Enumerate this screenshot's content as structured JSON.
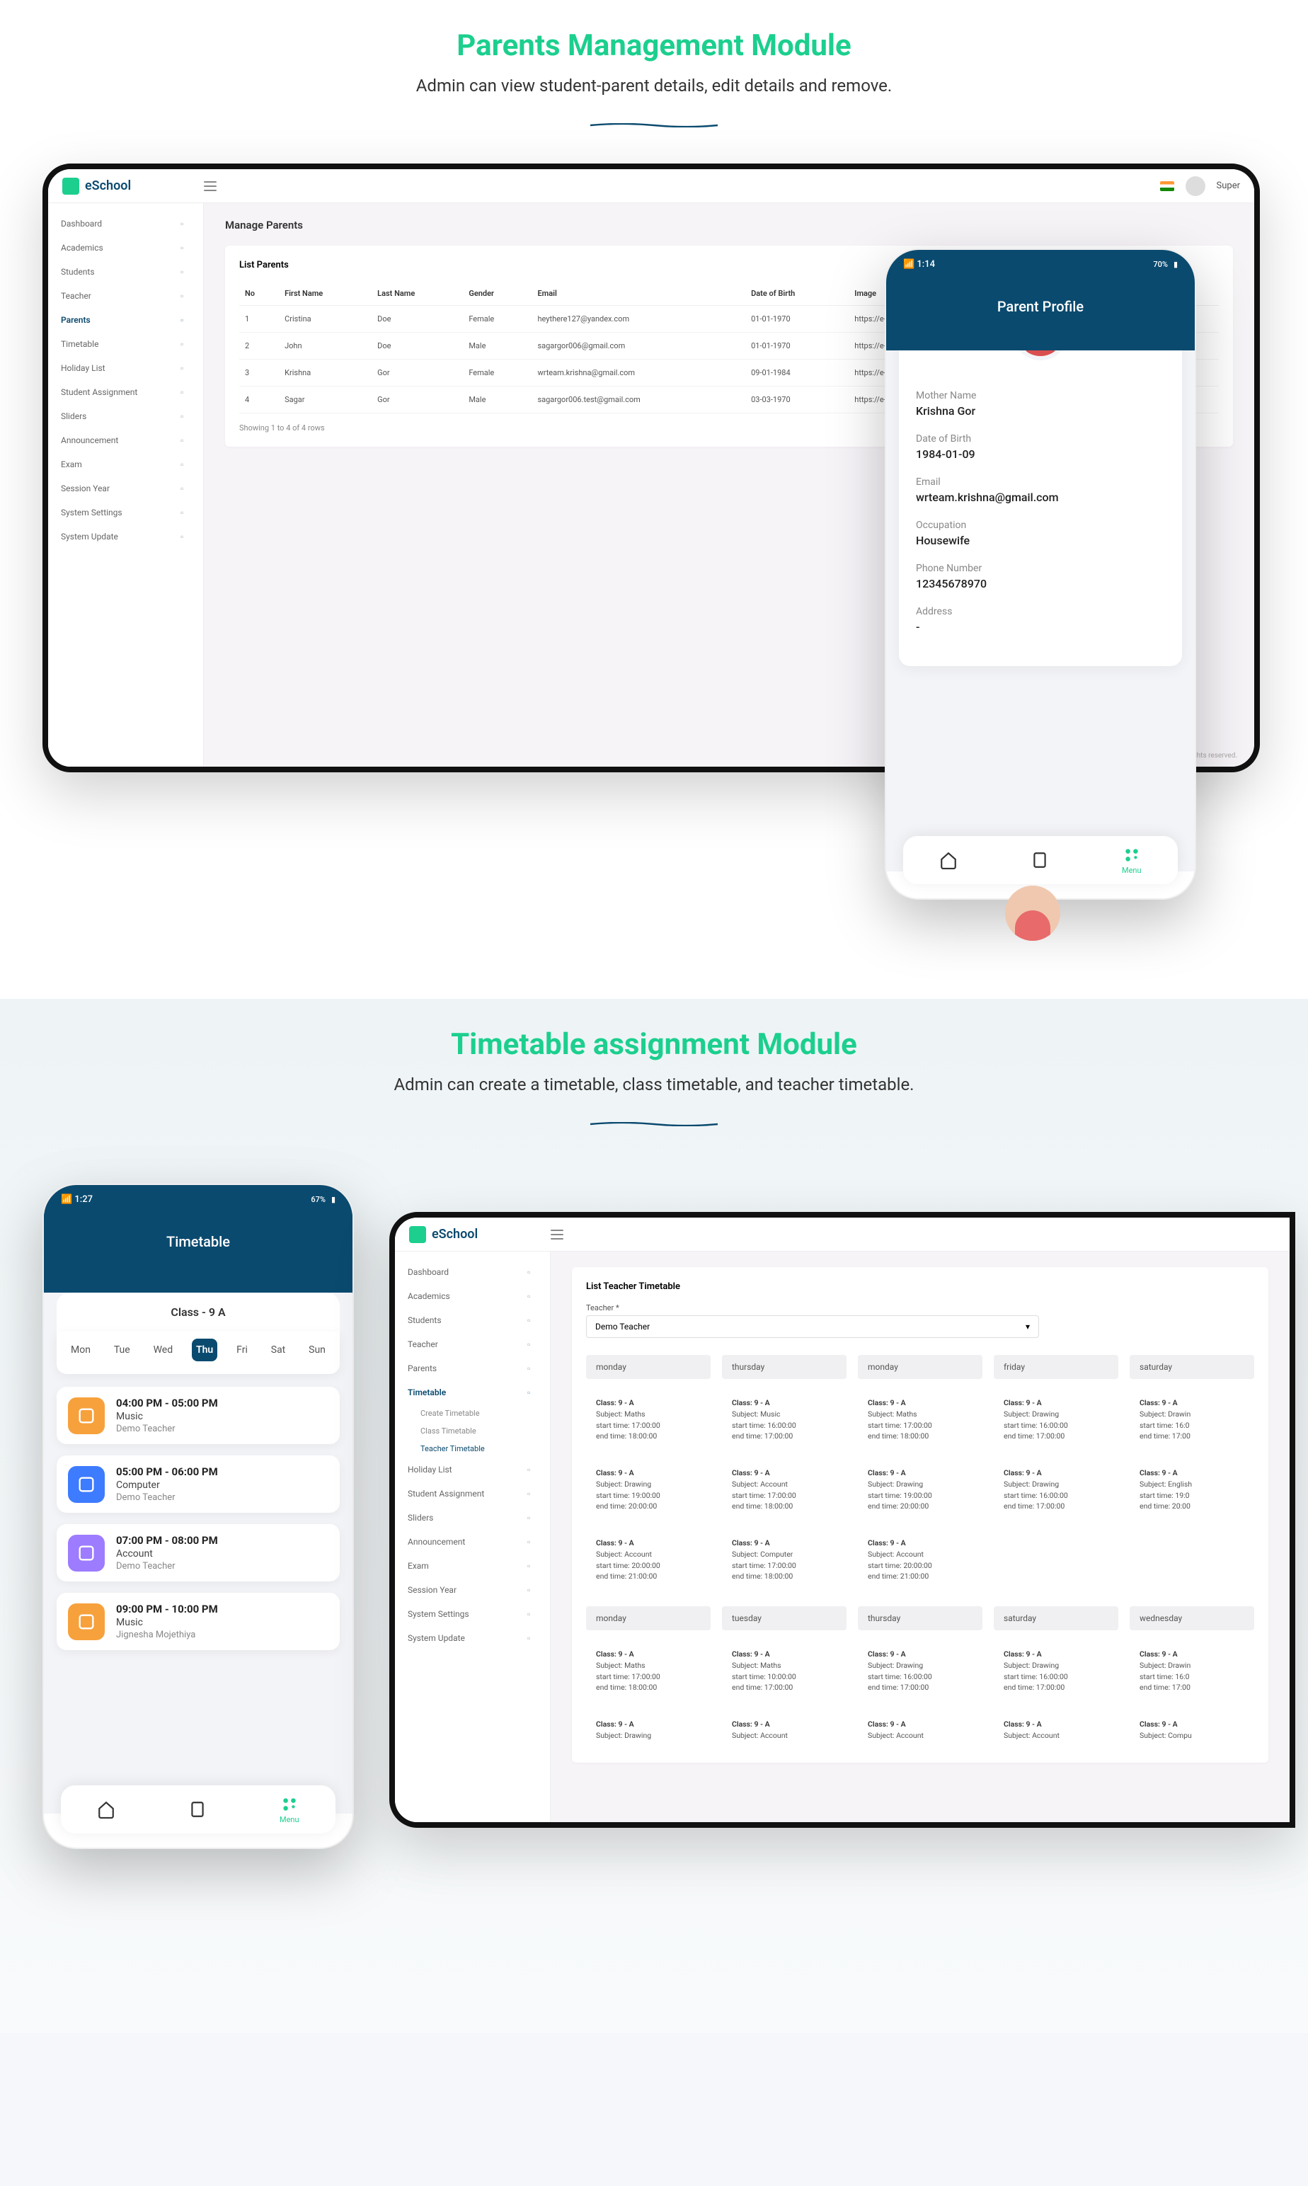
{
  "section1": {
    "title": "Parents Management Module",
    "subtitle": "Admin can view student-parent details, edit details and remove."
  },
  "section2": {
    "title": "Timetable assignment Module",
    "subtitle": "Admin can create a timetable, class timetable, and teacher timetable."
  },
  "brand": "eSchool",
  "topbar_user": "Super",
  "copyright": "All rights reserved.",
  "sidebar_items": [
    "Dashboard",
    "Academics",
    "Students",
    "Teacher",
    "Parents",
    "Timetable",
    "Holiday List",
    "Student Assignment",
    "Sliders",
    "Announcement",
    "Exam",
    "Session Year",
    "System Settings",
    "System Update"
  ],
  "sidebar_tt_sub": [
    "Create Timetable",
    "Class Timetable",
    "Teacher Timetable"
  ],
  "parents_page": {
    "heading": "Manage Parents",
    "card_title": "List Parents",
    "columns": [
      "No",
      "First Name",
      "Last Name",
      "Gender",
      "Email",
      "Date of Birth",
      "Image"
    ],
    "rows": [
      {
        "no": "1",
        "first": "Cristina",
        "last": "Doe",
        "gender": "Female",
        "email": "heythere127@yandex.com",
        "dob": "01-01-1970",
        "img": "https://e-school.wrteam.in/storage/parents/ylcoUI86"
      },
      {
        "no": "2",
        "first": "John",
        "last": "Doe",
        "gender": "Male",
        "email": "sagargor006@gmail.com",
        "dob": "01-01-1970",
        "img": "https://e-school.wrteam.in/storage/parents/jFrVXjtW"
      },
      {
        "no": "3",
        "first": "Krishna",
        "last": "Gor",
        "gender": "Female",
        "email": "wrteam.krishna@gmail.com",
        "dob": "09-01-1984",
        "img": "https://e-school.wrteam.in/storage/parents/NXvoCBR"
      },
      {
        "no": "4",
        "first": "Sagar",
        "last": "Gor",
        "gender": "Male",
        "email": "sagargor006.test@gmail.com",
        "dob": "03-03-1970",
        "img": "https://e-school.wrteam.in/storage/parents/s9iIbGYc"
      }
    ],
    "footnote": "Showing 1 to 4 of 4 rows"
  },
  "phone_profile": {
    "status_time": "1:14",
    "status_batt": "70%",
    "title": "Parent Profile",
    "fields": [
      {
        "label": "Mother Name",
        "value": "Krishna Gor"
      },
      {
        "label": "Date of Birth",
        "value": "1984-01-09"
      },
      {
        "label": "Email",
        "value": "wrteam.krishna@gmail.com"
      },
      {
        "label": "Occupation",
        "value": "Housewife"
      },
      {
        "label": "Phone Number",
        "value": "12345678970"
      },
      {
        "label": "Address",
        "value": "-"
      }
    ],
    "menu_label": "Menu"
  },
  "phone_tt": {
    "status_time": "1:27",
    "status_batt": "67%",
    "title": "Timetable",
    "class": "Class - 9 A",
    "days": [
      "Mon",
      "Tue",
      "Wed",
      "Thu",
      "Fri",
      "Sat",
      "Sun"
    ],
    "active_day": 3,
    "items": [
      {
        "time": "04:00 PM - 05:00 PM",
        "subject": "Music",
        "teacher": "Demo Teacher",
        "color": "#f7a13c"
      },
      {
        "time": "05:00 PM - 06:00 PM",
        "subject": "Computer",
        "teacher": "Demo Teacher",
        "color": "#3d7bff"
      },
      {
        "time": "07:00 PM - 08:00 PM",
        "subject": "Account",
        "teacher": "Demo Teacher",
        "color": "#9d7cff"
      },
      {
        "time": "09:00 PM - 10:00 PM",
        "subject": "Music",
        "teacher": "Jignesha Mojethiya",
        "color": "#f7a13c"
      }
    ],
    "menu_label": "Menu"
  },
  "tt_desktop": {
    "heading": "List Teacher Timetable",
    "teacher_label": "Teacher *",
    "teacher_value": "Demo Teacher",
    "row1": {
      "headers": [
        "monday",
        "thursday",
        "monday",
        "friday",
        "saturday"
      ],
      "cells": [
        [
          {
            "class": "Class: 9 - A",
            "subject": "Subject: Maths",
            "start": "start time: 17:00:00",
            "end": "end time: 18:00:00"
          },
          {
            "class": "Class: 9 - A",
            "subject": "Subject: Drawing",
            "start": "start time: 19:00:00",
            "end": "end time: 20:00:00"
          },
          {
            "class": "Class: 9 - A",
            "subject": "Subject: Account",
            "start": "start time: 20:00:00",
            "end": "end time: 21:00:00"
          }
        ],
        [
          {
            "class": "Class: 9 - A",
            "subject": "Subject: Music",
            "start": "start time: 16:00:00",
            "end": "end time: 17:00:00"
          },
          {
            "class": "Class: 9 - A",
            "subject": "Subject: Account",
            "start": "start time: 17:00:00",
            "end": "end time: 18:00:00"
          },
          {
            "class": "Class: 9 - A",
            "subject": "Subject: Computer",
            "start": "start time: 17:00:00",
            "end": "end time: 18:00:00"
          }
        ],
        [
          {
            "class": "Class: 9 - A",
            "subject": "Subject: Maths",
            "start": "start time: 17:00:00",
            "end": "end time: 18:00:00"
          },
          {
            "class": "Class: 9 - A",
            "subject": "Subject: Drawing",
            "start": "start time: 19:00:00",
            "end": "end time: 20:00:00"
          },
          {
            "class": "Class: 9 - A",
            "subject": "Subject: Account",
            "start": "start time: 20:00:00",
            "end": "end time: 21:00:00"
          }
        ],
        [
          {
            "class": "Class: 9 - A",
            "subject": "Subject: Drawing",
            "start": "start time: 16:00:00",
            "end": "end time: 17:00:00"
          },
          {
            "class": "Class: 9 - A",
            "subject": "Subject: Drawing",
            "start": "start time: 16:00:00",
            "end": "end time: 17:00:00"
          },
          {
            "class": "",
            "subject": "",
            "start": "",
            "end": ""
          }
        ],
        [
          {
            "class": "Class: 9 - A",
            "subject": "Subject: Drawin",
            "start": "start time: 16:0",
            "end": "end time: 17:00"
          },
          {
            "class": "Class: 9 - A",
            "subject": "Subject: English",
            "start": "start time: 19:0",
            "end": "end time: 20:00"
          },
          {
            "class": "",
            "subject": "",
            "start": "",
            "end": ""
          }
        ]
      ]
    },
    "row2": {
      "headers": [
        "monday",
        "tuesday",
        "thursday",
        "saturday",
        "wednesday"
      ],
      "cells": [
        [
          {
            "class": "Class: 9 - A",
            "subject": "Subject: Maths",
            "start": "start time: 17:00:00",
            "end": "end time: 18:00:00"
          },
          {
            "class": "Class: 9 - A",
            "subject": "Subject: Drawing",
            "start": "",
            "end": ""
          }
        ],
        [
          {
            "class": "Class: 9 - A",
            "subject": "Subject: Maths",
            "start": "start time: 10:00:00",
            "end": "end time: 17:00:00"
          },
          {
            "class": "Class: 9 - A",
            "subject": "Subject: Account",
            "start": "",
            "end": ""
          }
        ],
        [
          {
            "class": "Class: 9 - A",
            "subject": "Subject: Drawing",
            "start": "start time: 16:00:00",
            "end": "end time: 17:00:00"
          },
          {
            "class": "Class: 9 - A",
            "subject": "Subject: Account",
            "start": "",
            "end": ""
          }
        ],
        [
          {
            "class": "Class: 9 - A",
            "subject": "Subject: Drawing",
            "start": "start time: 16:00:00",
            "end": "end time: 17:00:00"
          },
          {
            "class": "Class: 9 - A",
            "subject": "Subject: Account",
            "start": "",
            "end": ""
          }
        ],
        [
          {
            "class": "Class: 9 - A",
            "subject": "Subject: Drawin",
            "start": "start time: 16:0",
            "end": "end time: 17:00"
          },
          {
            "class": "Class: 9 - A",
            "subject": "Subject: Compu",
            "start": "",
            "end": ""
          }
        ]
      ]
    }
  }
}
